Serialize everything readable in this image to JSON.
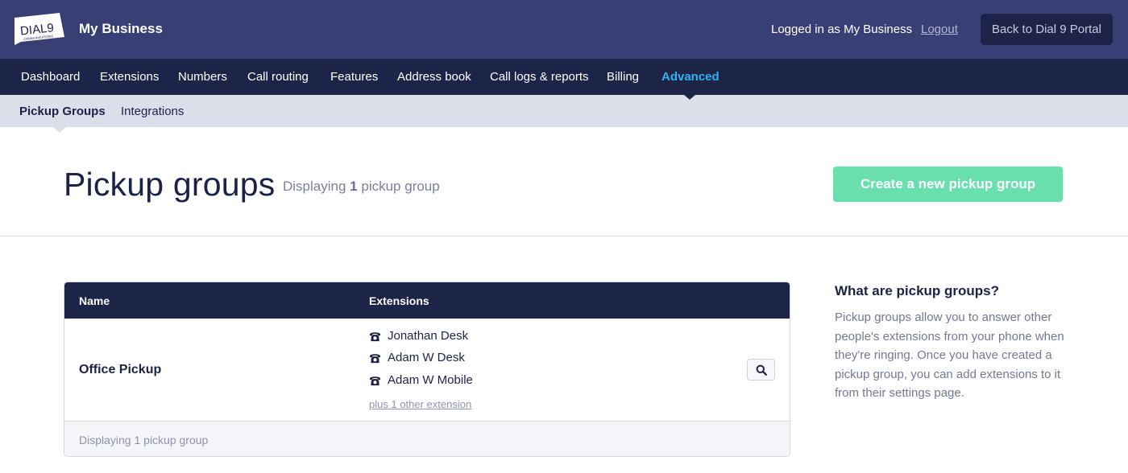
{
  "brand": {
    "logo_text": "DIAL9",
    "logo_subtext": "COMMUNICATIONS",
    "business_name": "My Business"
  },
  "account": {
    "logged_in_text": "Logged in as My Business",
    "logout_label": "Logout",
    "back_label": "Back to Dial 9 Portal"
  },
  "main_nav": {
    "items": [
      {
        "label": "Dashboard",
        "active": false
      },
      {
        "label": "Extensions",
        "active": false
      },
      {
        "label": "Numbers",
        "active": false
      },
      {
        "label": "Call routing",
        "active": false
      },
      {
        "label": "Features",
        "active": false
      },
      {
        "label": "Address book",
        "active": false
      },
      {
        "label": "Call logs & reports",
        "active": false
      },
      {
        "label": "Billing",
        "active": false
      },
      {
        "label": "Advanced",
        "active": true
      }
    ]
  },
  "sub_nav": {
    "items": [
      {
        "label": "Pickup Groups",
        "active": true
      },
      {
        "label": "Integrations",
        "active": false
      }
    ]
  },
  "page": {
    "title": "Pickup groups",
    "subtitle_prefix": "Displaying",
    "subtitle_count": "1",
    "subtitle_suffix": "pickup group",
    "create_label": "Create a new pickup group"
  },
  "table": {
    "columns": [
      "Name",
      "Extensions"
    ],
    "rows": [
      {
        "name": "Office Pickup",
        "extensions": [
          "Jonathan Desk",
          "Adam W Desk",
          "Adam W Mobile"
        ],
        "more_link": "plus 1 other extension",
        "action_icon": "search-icon"
      }
    ],
    "footer": "Displaying 1 pickup group"
  },
  "sidebar": {
    "title": "What are pickup groups?",
    "text": "Pickup groups allow you to answer other people's extensions from your phone when they're ringing. Once you have created a pickup group, you can add extensions to it from their settings page."
  },
  "colors": {
    "topbar": "#383f74",
    "nav": "#1c2448",
    "subnav": "#dcdee9",
    "active_nav": "#2cb5f0",
    "create_button": "#69dfae"
  }
}
